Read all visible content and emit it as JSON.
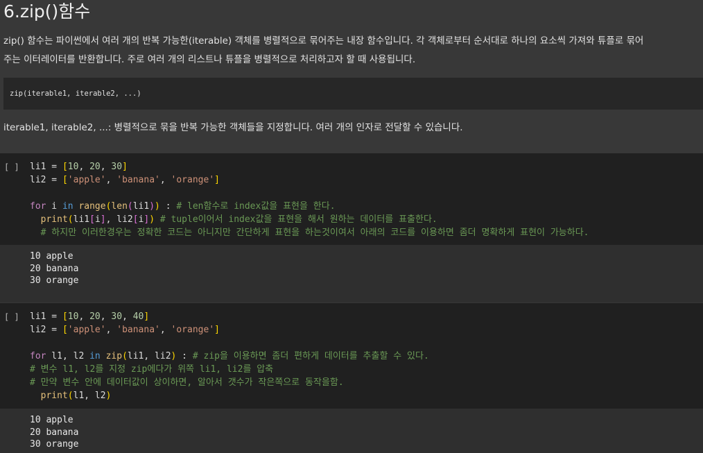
{
  "title": "6.zip()함수",
  "intro_line1": "zip() 함수는 파이썬에서 여러 개의 반복 가능한(iterable) 객체를 병렬적으로 묶어주는 내장 함수입니다. 각 객체로부터 순서대로 하나의 요소씩 가져와 튜플로 묶어",
  "intro_line2": "주는 이터레이터를 반환합니다. 주로 여러 개의 리스트나 튜플을 병렬적으로 처리하고자 할 때 사용됩니다.",
  "syntax": "zip(iterable1, iterable2, ...)",
  "param_desc": "iterable1, iterable2, ...: 병렬적으로 묶을 반복 가능한 객체들을 지정합니다. 여러 개의 인자로 전달할 수 있습니다.",
  "cell1": {
    "bracket": "[ ]",
    "lines": [
      [
        [
          "id",
          "li1 = "
        ],
        [
          "br",
          "["
        ],
        [
          "num",
          "10"
        ],
        [
          "id",
          ", "
        ],
        [
          "num",
          "20"
        ],
        [
          "id",
          ", "
        ],
        [
          "num",
          "30"
        ],
        [
          "br",
          "]"
        ]
      ],
      [
        [
          "id",
          "li2 = "
        ],
        [
          "br",
          "["
        ],
        [
          "str",
          "'apple'"
        ],
        [
          "id",
          ", "
        ],
        [
          "str",
          "'banana'"
        ],
        [
          "id",
          ", "
        ],
        [
          "str",
          "'orange'"
        ],
        [
          "br",
          "]"
        ]
      ],
      [],
      [
        [
          "kw",
          "for"
        ],
        [
          "id",
          " i "
        ],
        [
          "bl",
          "in"
        ],
        [
          "id",
          " "
        ],
        [
          "fn",
          "range"
        ],
        [
          "br",
          "("
        ],
        [
          "fn",
          "len"
        ],
        [
          "pk",
          "("
        ],
        [
          "id",
          "li1"
        ],
        [
          "pk",
          ")"
        ],
        [
          "br",
          ")"
        ],
        [
          "id",
          " : "
        ],
        [
          "cm",
          "# len함수로 index값을 표현을 한다."
        ]
      ],
      [
        [
          "id",
          "  "
        ],
        [
          "fn",
          "print"
        ],
        [
          "br",
          "("
        ],
        [
          "id",
          "li1"
        ],
        [
          "pk",
          "["
        ],
        [
          "id",
          "i"
        ],
        [
          "pk",
          "]"
        ],
        [
          "id",
          ", li2"
        ],
        [
          "pk",
          "["
        ],
        [
          "id",
          "i"
        ],
        [
          "pk",
          "]"
        ],
        [
          "br",
          ")"
        ],
        [
          "id",
          " "
        ],
        [
          "cm",
          "# tuple이어서 index값을 표현을 해서 원하는 데이터를 표출한다."
        ]
      ],
      [
        [
          "id",
          "  "
        ],
        [
          "cm",
          "# 하지만 이러한경우는 정확한 코드는 아니지만 간단하게 표현을 하는것이여서 아래의 코드를 이용하면 좀더 명확하게 표현이 가능하다."
        ]
      ]
    ],
    "output": [
      "10 apple",
      "20 banana",
      "30 orange"
    ]
  },
  "cell2": {
    "bracket": "[ ]",
    "lines": [
      [
        [
          "id",
          "li1 = "
        ],
        [
          "br",
          "["
        ],
        [
          "num",
          "10"
        ],
        [
          "id",
          ", "
        ],
        [
          "num",
          "20"
        ],
        [
          "id",
          ", "
        ],
        [
          "num",
          "30"
        ],
        [
          "id",
          ", "
        ],
        [
          "num",
          "40"
        ],
        [
          "br",
          "]"
        ]
      ],
      [
        [
          "id",
          "li2 = "
        ],
        [
          "br",
          "["
        ],
        [
          "str",
          "'apple'"
        ],
        [
          "id",
          ", "
        ],
        [
          "str",
          "'banana'"
        ],
        [
          "id",
          ", "
        ],
        [
          "str",
          "'orange'"
        ],
        [
          "br",
          "]"
        ]
      ],
      [],
      [
        [
          "kw",
          "for"
        ],
        [
          "id",
          " l1, l2 "
        ],
        [
          "bl",
          "in"
        ],
        [
          "id",
          " "
        ],
        [
          "fn",
          "zip"
        ],
        [
          "br",
          "("
        ],
        [
          "id",
          "li1, li2"
        ],
        [
          "br",
          ")"
        ],
        [
          "id",
          " : "
        ],
        [
          "cm",
          "# zip을 이용하면 좀더 편하게 데이터를 추출할 수 있다."
        ]
      ],
      [
        [
          "cm",
          "# 변수 l1, l2를 지정 zip에다가 위쪽 li1, li2를 압축"
        ]
      ],
      [
        [
          "cm",
          "# 만약 변수 안에 데이터값이 상이하면, 알아서 갯수가 작은쪽으로 동작을함."
        ]
      ],
      [
        [
          "id",
          "  "
        ],
        [
          "fn",
          "print"
        ],
        [
          "br",
          "("
        ],
        [
          "id",
          "l1, l2"
        ],
        [
          "br",
          ")"
        ]
      ]
    ],
    "output": [
      "10 apple",
      "20 banana",
      "30 orange"
    ]
  }
}
